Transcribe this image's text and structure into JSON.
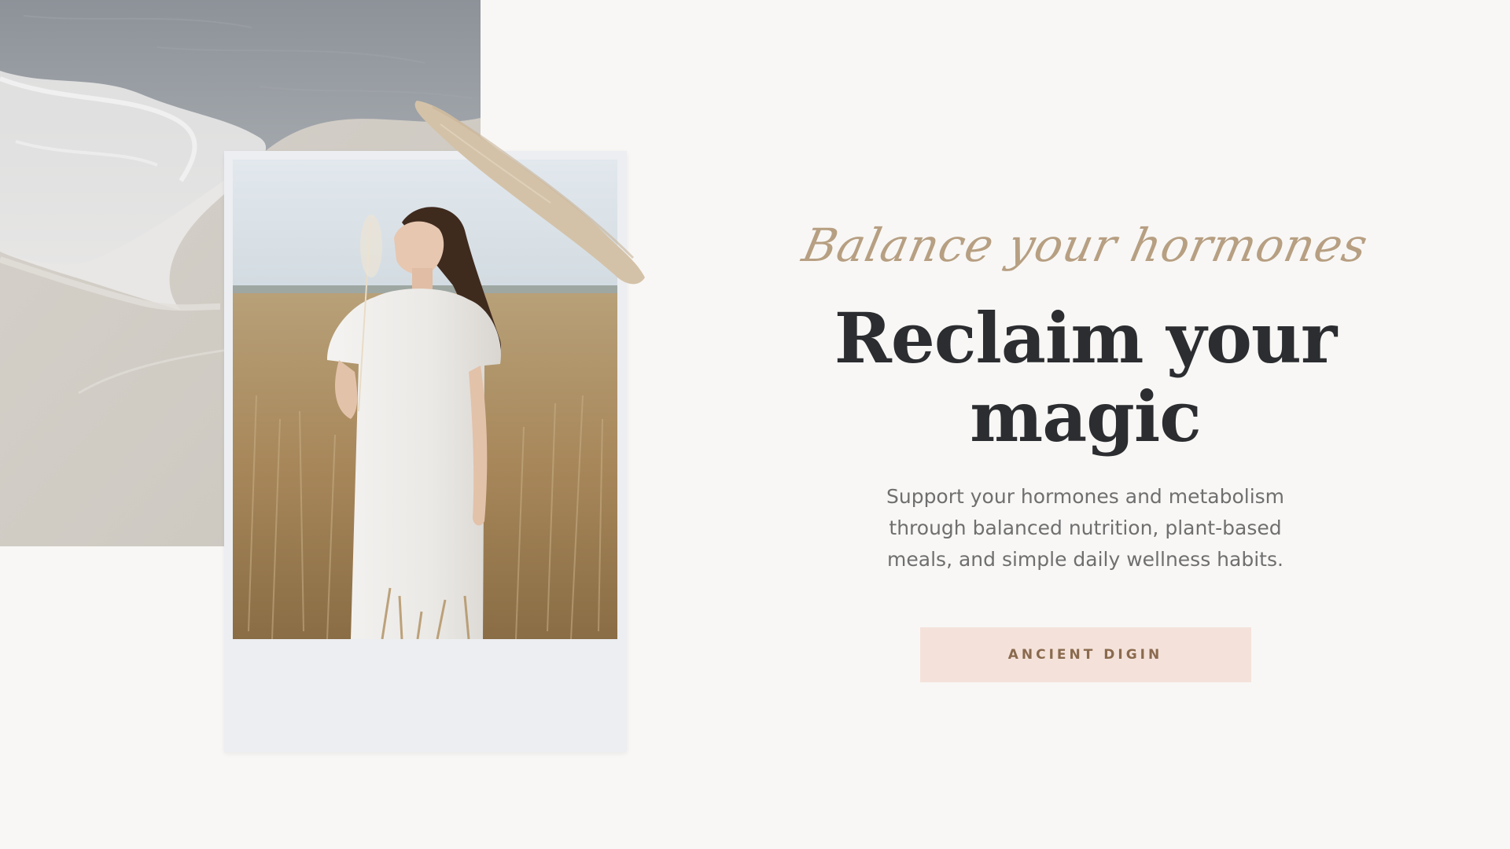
{
  "hero": {
    "script_title": "Balance your hormones",
    "headline": "Reclaim your magic",
    "description": "Support your hormones and metabolism through balanced nutrition, plant-based meals, and simple daily wellness habits.",
    "cta_label": "ANCIENT DIGIN"
  },
  "colors": {
    "background": "#f8f7f5",
    "accent_script": "#b79f82",
    "headline": "#2b2d30",
    "body_text": "#6f6f6f",
    "button_bg": "#f4e2da",
    "button_text": "#8a6a4e",
    "brush_stroke": "#d4c2a8"
  }
}
